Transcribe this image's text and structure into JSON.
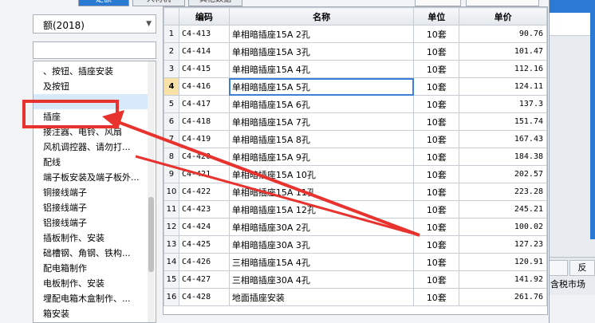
{
  "background": {
    "tab_partial": "反",
    "label_partial": "含税市场"
  },
  "dialog": {
    "tabs": [
      "定额",
      "人材机",
      "其他数据"
    ]
  },
  "left_panel": {
    "combo_value": "额(2018)",
    "search_placeholder": "",
    "tree_items": [
      "、按钮、插座安装",
      "及按钮",
      "",
      "",
      "插座",
      "接注器、电铃、风扇",
      "风机调控器、请勿打...",
      "配线",
      "端子板安装及端子板外...",
      "铜接线端子",
      "铝接线端子",
      "铝接线端子",
      "插板制作、安装",
      "础槽钢、角钢、铁构...",
      "配电箱制作",
      "电板制作、安装",
      "埋配电箱木盒制作、...",
      "箱安装"
    ]
  },
  "grid": {
    "headers": [
      "",
      "编码",
      "名称",
      "单位",
      "单价"
    ],
    "rows": [
      {
        "idx": "1",
        "code": "C4-413",
        "name": "单相暗插座15A 2孔",
        "unit": "10套",
        "price": "90.76"
      },
      {
        "idx": "2",
        "code": "C4-414",
        "name": "单相暗插座15A 3孔",
        "unit": "10套",
        "price": "101.47"
      },
      {
        "idx": "3",
        "code": "C4-415",
        "name": "单相暗插座15A 4孔",
        "unit": "10套",
        "price": "112.16"
      },
      {
        "idx": "4",
        "code": "C4-416",
        "name": "单相暗插座15A 5孔",
        "unit": "10套",
        "price": "124.11"
      },
      {
        "idx": "5",
        "code": "C4-417",
        "name": "单相暗插座15A 6孔",
        "unit": "10套",
        "price": "137.3"
      },
      {
        "idx": "6",
        "code": "C4-418",
        "name": "单相暗插座15A 7孔",
        "unit": "10套",
        "price": "151.74"
      },
      {
        "idx": "7",
        "code": "C4-419",
        "name": "单相暗插座15A 8孔",
        "unit": "10套",
        "price": "167.43"
      },
      {
        "idx": "8",
        "code": "C4-420",
        "name": "单相暗插座15A 9孔",
        "unit": "10套",
        "price": "184.38"
      },
      {
        "idx": "9",
        "code": "C4-421",
        "name": "单相暗插座15A 10孔",
        "unit": "10套",
        "price": "202.57"
      },
      {
        "idx": "10",
        "code": "C4-422",
        "name": "单相暗插座15A 11孔",
        "unit": "10套",
        "price": "223.28"
      },
      {
        "idx": "11",
        "code": "C4-423",
        "name": "单相暗插座15A 12孔",
        "unit": "10套",
        "price": "245.21"
      },
      {
        "idx": "12",
        "code": "C4-424",
        "name": "单相暗插座30A 2孔",
        "unit": "10套",
        "price": "100.02"
      },
      {
        "idx": "13",
        "code": "C4-425",
        "name": "单相暗插座30A 3孔",
        "unit": "10套",
        "price": "127.23"
      },
      {
        "idx": "14",
        "code": "C4-426",
        "name": "三相暗插座15A 4孔",
        "unit": "10套",
        "price": "120.91"
      },
      {
        "idx": "15",
        "code": "C4-427",
        "name": "三相暗插座30A 4孔",
        "unit": "10套",
        "price": "141.92"
      },
      {
        "idx": "16",
        "code": "C4-428",
        "name": "地面插座安装",
        "unit": "10套",
        "price": "261.76"
      }
    ],
    "current_row": 4
  },
  "annotation": {
    "color": "#e8322d"
  }
}
